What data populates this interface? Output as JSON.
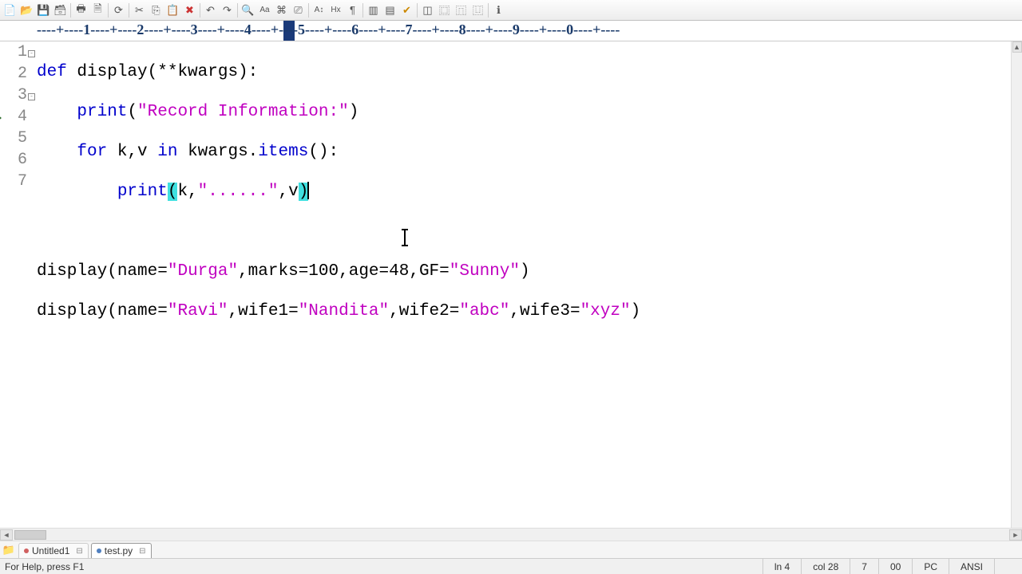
{
  "toolbar": {
    "icons": [
      "new",
      "open",
      "save",
      "saveall",
      "close",
      "print",
      "preview",
      "refresh",
      "cut",
      "copy",
      "paste",
      "delete",
      "undo",
      "redo",
      "find",
      "findreplace",
      "aA",
      "link",
      "clear",
      "Aplus",
      "Hx",
      "pilcrow",
      "panel1",
      "panel2",
      "check",
      "win1",
      "win2",
      "win3",
      "win4",
      "help"
    ]
  },
  "ruler": {
    "text": "----+----1----+----2----+----3----+----4----+----5----+----6----+----7----+----8----+----9----+----0----+----"
  },
  "code": {
    "lines": [
      {
        "n": "1",
        "fold": true
      },
      {
        "n": "2"
      },
      {
        "n": "3",
        "fold": true
      },
      {
        "n": "4",
        "current": true
      },
      {
        "n": "5"
      },
      {
        "n": "6"
      },
      {
        "n": "7"
      }
    ],
    "l1": {
      "def": "def",
      "name": "display",
      "rest": "(**kwargs):"
    },
    "l2": {
      "indent": "    ",
      "print": "print",
      "open": "(",
      "str": "\"Record Information:\"",
      "close": ")"
    },
    "l3": {
      "indent": "    ",
      "for": "for",
      "vars": " k,v ",
      "in": "in",
      "target": " kwargs.",
      "items": "items",
      "rest": "():"
    },
    "l4": {
      "indent": "        ",
      "print": "print",
      "open": "(",
      "args1": "k,",
      "str": "\"......\"",
      "args2": ",v",
      "close": ")"
    },
    "l6": {
      "call": "display(",
      "p1": "name",
      "eq1": "=",
      "s1": "\"Durga\"",
      "c1": ",marks=",
      "n1": "100",
      "c2": ",age=",
      "n2": "48",
      "c3": ",GF=",
      "s2": "\"Sunny\"",
      "end": ")"
    },
    "l7": {
      "call": "display(",
      "p1": "name",
      "eq1": "=",
      "s1": "\"Ravi\"",
      "c1": ",wife1=",
      "s2": "\"Nandita\"",
      "c2": ",wife2=",
      "s3": "\"abc\"",
      "c3": ",wife3=",
      "s4": "\"xyz\"",
      "end": ")"
    }
  },
  "tabs": {
    "items": [
      {
        "label": "Untitled1",
        "active": false
      },
      {
        "label": "test.py",
        "active": true
      }
    ]
  },
  "status": {
    "help": "For Help, press F1",
    "ln": "ln 4",
    "col": "col 28",
    "lines": "7",
    "zero": "00",
    "mode": "PC",
    "enc": "ANSI"
  }
}
